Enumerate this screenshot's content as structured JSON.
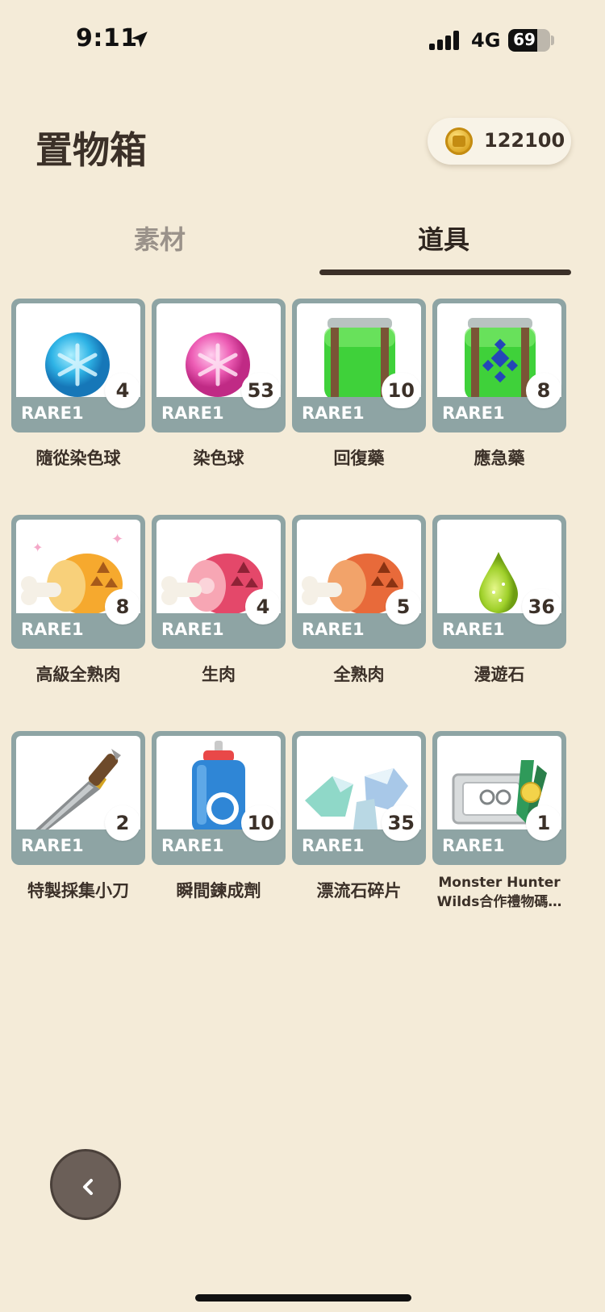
{
  "status": {
    "time": "9:11",
    "network": "4G",
    "battery": "69",
    "battery_level": 0.69
  },
  "header": {
    "title": "置物箱",
    "coins": "122100"
  },
  "tabs": [
    {
      "label": "素材",
      "active": false
    },
    {
      "label": "道具",
      "active": true
    }
  ],
  "items": [
    {
      "name": "隨從染色球",
      "rarity": "RARE1",
      "qty": "4",
      "icon": "blue-dye-ball"
    },
    {
      "name": "染色球",
      "rarity": "RARE1",
      "qty": "53",
      "icon": "pink-dye-ball"
    },
    {
      "name": "回復藥",
      "rarity": "RARE1",
      "qty": "10",
      "icon": "green-potion-jar"
    },
    {
      "name": "應急藥",
      "rarity": "RARE1",
      "qty": "8",
      "icon": "emergency-potion-jar"
    },
    {
      "name": "高級全熟肉",
      "rarity": "RARE1",
      "qty": "8",
      "icon": "golden-meat"
    },
    {
      "name": "生肉",
      "rarity": "RARE1",
      "qty": "4",
      "icon": "raw-meat"
    },
    {
      "name": "全熟肉",
      "rarity": "RARE1",
      "qty": "5",
      "icon": "well-done-meat"
    },
    {
      "name": "漫遊石",
      "rarity": "RARE1",
      "qty": "36",
      "icon": "green-drop"
    },
    {
      "name": "特製採集小刀",
      "rarity": "RARE1",
      "qty": "2",
      "icon": "carving-knife"
    },
    {
      "name": "瞬間鍊成劑",
      "rarity": "RARE1",
      "qty": "10",
      "icon": "spray-can"
    },
    {
      "name": "漂流石碎片",
      "rarity": "RARE1",
      "qty": "35",
      "icon": "crystal-shards"
    },
    {
      "name": "Monster Hunter Wilds合作禮物碼…",
      "rarity": "RARE1",
      "qty": "1",
      "icon": "ticket-ribbon"
    }
  ],
  "colors": {
    "background": "#f4ebd8",
    "card": "#8ea4a4",
    "text": "#3b3028"
  }
}
